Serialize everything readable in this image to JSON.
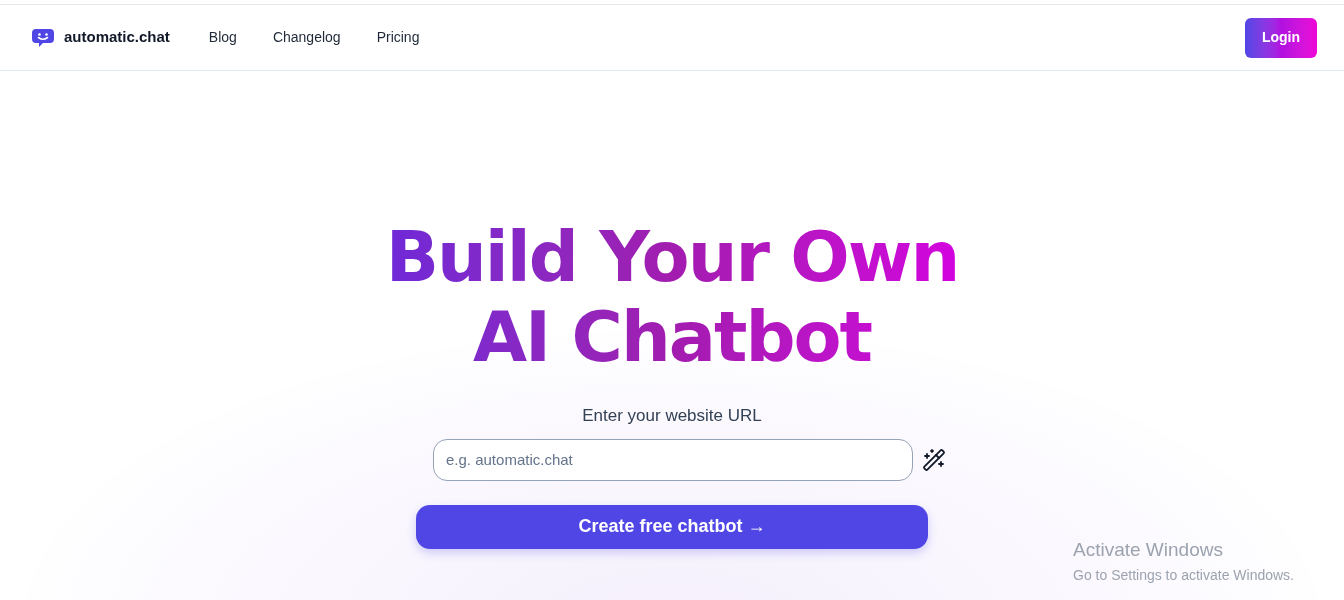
{
  "brand": {
    "name": "automatic.chat"
  },
  "nav": [
    {
      "label": "Blog"
    },
    {
      "label": "Changelog"
    },
    {
      "label": "Pricing"
    }
  ],
  "login": {
    "label": "Login"
  },
  "hero": {
    "title": "Build Your Own AI Chatbot",
    "field_label": "Enter your website URL",
    "placeholder": "e.g. automatic.chat",
    "cta": "Create free chatbot →"
  },
  "os_notice": {
    "title": "Activate Windows",
    "subtitle": "Go to Settings to activate Windows."
  }
}
